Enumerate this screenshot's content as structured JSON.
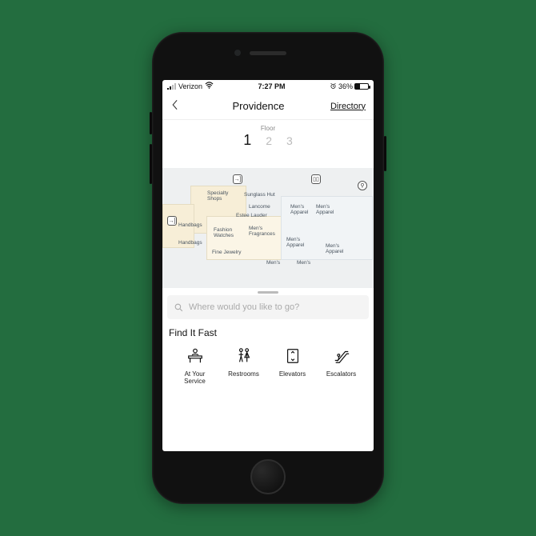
{
  "status_bar": {
    "carrier": "Verizon",
    "time": "7:27 PM",
    "battery_percent": "36%"
  },
  "header": {
    "title": "Providence",
    "directory_link": "Directory"
  },
  "floor_picker": {
    "label": "Floor",
    "floors": [
      "1",
      "2",
      "3"
    ],
    "active_index": 0
  },
  "map": {
    "labels": {
      "specialty_shops": "Specialty\nShops",
      "sunglass_hut": "Sunglass Hut",
      "lancome": "Lancome",
      "estee_lauder": "Estee Lauder",
      "handbags1": "Handbags",
      "handbags2": "Handbags",
      "fashion_watches": "Fashion\nWatches",
      "mens_fragrances": "Men's\nFragrances",
      "fine_jewelry": "Fine Jewelry",
      "mens_apparel1": "Men's\nApparel",
      "mens_apparel2": "Men's\nApparel",
      "mens_apparel3": "Men's\nApparel",
      "mens_apparel4": "Men's\nApparel",
      "mens1": "Men's",
      "mens2": "Men's"
    }
  },
  "search": {
    "placeholder": "Where would you like to go?"
  },
  "find_it_fast": {
    "heading": "Find It Fast",
    "items": [
      {
        "label": "At Your\nService"
      },
      {
        "label": "Restrooms"
      },
      {
        "label": "Elevators"
      },
      {
        "label": "Escalators"
      }
    ]
  }
}
